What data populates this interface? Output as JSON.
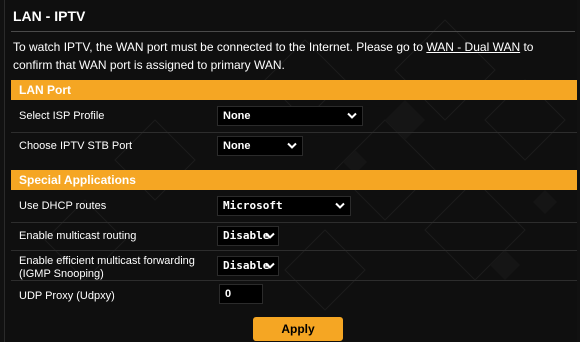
{
  "page": {
    "title": "LAN - IPTV",
    "description_pre": "To watch IPTV, the WAN port must be connected to the Internet. Please go to ",
    "description_link": "WAN - Dual WAN",
    "description_post": " to confirm that WAN port is assigned to primary WAN."
  },
  "lan_port": {
    "section_title": "LAN Port",
    "isp_profile_label": "Select ISP Profile",
    "isp_profile_value": "None",
    "stb_port_label": "Choose IPTV STB Port",
    "stb_port_value": "None"
  },
  "special_apps": {
    "section_title": "Special Applications",
    "dhcp_routes_label": "Use DHCP routes",
    "dhcp_routes_value": "Microsoft",
    "multicast_label": "Enable multicast routing",
    "multicast_value": "Disable",
    "igmp_label": "Enable efficient multicast forwarding (IGMP Snooping)",
    "igmp_value": "Disable",
    "udp_proxy_label": "UDP Proxy (Udpxy)",
    "udp_proxy_value": "0"
  },
  "actions": {
    "apply_label": "Apply"
  },
  "colors": {
    "accent": "#f5a623",
    "background": "#0f0f0f",
    "field_bg": "#000000"
  },
  "icons": {
    "dropdown": "chevron-down-icon"
  }
}
